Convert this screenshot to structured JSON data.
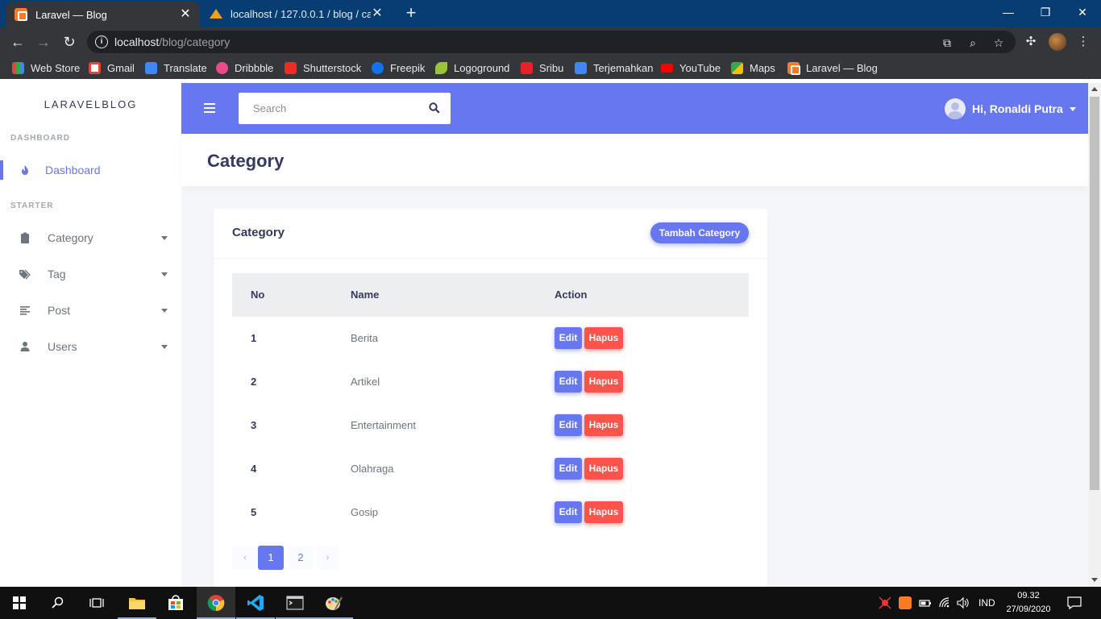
{
  "browser": {
    "tabs": [
      {
        "title": "Laravel — Blog",
        "active": true
      },
      {
        "title": "localhost / 127.0.0.1 / blog / cate",
        "active": false
      }
    ],
    "url_host": "localhost",
    "url_path": "/blog/category",
    "bookmarks": [
      "Web Store",
      "Gmail",
      "Translate",
      "Dribbble",
      "Shutterstock",
      "Freepik",
      "Logoground",
      "Sribu",
      "Terjemahkan",
      "YouTube",
      "Maps",
      "Laravel — Blog"
    ]
  },
  "sidebar": {
    "brand": "LARAVELBLOG",
    "section_dashboard": "DASHBOARD",
    "dashboard_label": "Dashboard",
    "section_starter": "STARTER",
    "items": [
      {
        "label": "Category"
      },
      {
        "label": "Tag"
      },
      {
        "label": "Post"
      },
      {
        "label": "Users"
      }
    ]
  },
  "navbar": {
    "search_placeholder": "Search",
    "user_greeting": "Hi, Ronaldi Putra"
  },
  "page": {
    "title": "Category",
    "card_title": "Category",
    "add_button": "Tambah Category",
    "columns": {
      "no": "No",
      "name": "Name",
      "action": "Action"
    },
    "rows": [
      {
        "no": "1",
        "name": "Berita"
      },
      {
        "no": "2",
        "name": "Artikel"
      },
      {
        "no": "3",
        "name": "Entertainment"
      },
      {
        "no": "4",
        "name": "Olahraga"
      },
      {
        "no": "5",
        "name": "Gosip"
      }
    ],
    "edit_label": "Edit",
    "delete_label": "Hapus",
    "pagination": {
      "prev": "‹",
      "pages": [
        "1",
        "2"
      ],
      "current": "1",
      "next": "›"
    }
  },
  "taskbar": {
    "language": "IND",
    "time": "09.32",
    "date": "27/09/2020"
  },
  "colors": {
    "primary": "#6777ef",
    "danger": "#fc544b"
  }
}
